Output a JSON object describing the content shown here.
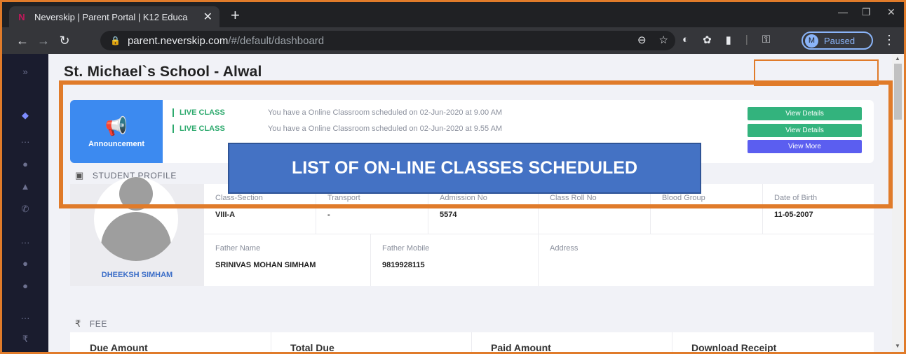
{
  "browser": {
    "tab_title": "Neverskip | Parent Portal | K12 Educa",
    "tab_close": "✕",
    "new_tab": "+",
    "url_host": "parent.neverskip.com",
    "url_path": "/#/default/dashboard",
    "profile_initial": "M",
    "profile_status": "Paused",
    "accent_color": "#8ab4f8"
  },
  "page": {
    "school_title": "St. Michael`s School - Alwal"
  },
  "announcement": {
    "badge_label": "Announcement",
    "items": [
      {
        "tag": "LIVE CLASS",
        "text": "You have a Online Classroom scheduled on 02-Jun-2020 at 9.00 AM",
        "button": "View Details"
      },
      {
        "tag": "LIVE CLASS",
        "text": "You have a Online Classroom scheduled on 02-Jun-2020 at 9.55 AM",
        "button": "View Details"
      }
    ],
    "view_more": "View More"
  },
  "student_profile": {
    "heading": "STUDENT PROFILE",
    "name": "DHEEKSH SIMHAM",
    "row1": [
      {
        "label": "Class-Section",
        "value": "VIII-A"
      },
      {
        "label": "Transport",
        "value": "-"
      },
      {
        "label": "Admission No",
        "value": "5574"
      },
      {
        "label": "Class Roll No",
        "value": ""
      },
      {
        "label": "Blood Group",
        "value": ""
      },
      {
        "label": "Date of Birth",
        "value": "11-05-2007"
      }
    ],
    "row2": [
      {
        "label": "Father Name",
        "value": "SRINIVAS MOHAN SIMHAM"
      },
      {
        "label": "Father Mobile",
        "value": "9819928115"
      },
      {
        "label": "Address",
        "value": ""
      }
    ]
  },
  "fee": {
    "heading": "FEE",
    "columns": [
      "Due Amount",
      "Total Due",
      "Paid Amount",
      "Download Receipt"
    ]
  },
  "callout": {
    "text": "LIST OF ON-LINE CLASSES SCHEDULED"
  }
}
